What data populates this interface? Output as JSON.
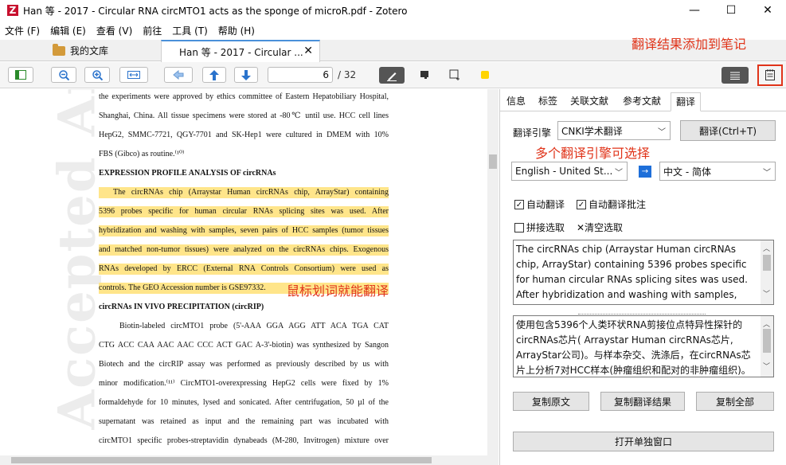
{
  "window": {
    "app_logo": "Z",
    "title": "Han 等 - 2017 - Circular RNA circMTO1 acts as the sponge of microR.pdf - Zotero",
    "minimize": "—",
    "maximize": "☐",
    "close": "✕"
  },
  "menu": [
    "文件 (F)",
    "编辑 (E)",
    "查看 (V)",
    "前往",
    "工具 (T)",
    "帮助 (H)"
  ],
  "tabs": {
    "library_label": "我的文库",
    "doc_label": "Han 等 - 2017 - Circular ...",
    "doc_close": "✕"
  },
  "annotations": {
    "note_hint": "翻译结果添加到笔记",
    "engine_hint": "多个翻译引擎可选择",
    "drag_hint": "鼠标划词就能翻译"
  },
  "toolbar": {
    "page_current": "6",
    "page_total": "/ 32"
  },
  "document": {
    "watermark": "Accepted Arti",
    "lines": [
      {
        "text": "the experiments were approved by ethics committee of Eastern Hepatobiliary Hospital,",
        "style": ""
      },
      {
        "text": "Shanghai, China. All tissue specimens were stored at -80℃ until use. HCC cell lines",
        "style": ""
      },
      {
        "text": "HepG2, SMMC-7721, QGY-7701 and SK-Hep1 were cultured in DMEM with 10%",
        "style": ""
      },
      {
        "text": "FBS (Gibco) as routine.⁽¹⁰⁾",
        "style": "last"
      },
      {
        "text": "EXPRESSION PROFILE ANALYSIS OF circRNAs",
        "style": "heading last"
      },
      {
        "text": "The circRNAs chip (Arraystar Human circRNAs chip, ArrayStar) containing",
        "style": "hl indent-small"
      },
      {
        "text": "5396 probes specific for human circular RNAs splicing sites was used. After",
        "style": "hl"
      },
      {
        "text": "hybridization and washing with samples, seven pairs of HCC samples (tumor tissues",
        "style": "hl"
      },
      {
        "text": "and matched non-tumor tissues) were analyzed on the circRNAs chips. Exogenous",
        "style": "hl"
      },
      {
        "text": "RNAs developed by ERCC (External RNA Controls Consortium) were used as",
        "style": "hl"
      },
      {
        "text": "controls. The GEO Accession number is GSE97332.",
        "style": "hl last"
      },
      {
        "text": "circRNAs IN VIVO PRECIPITATION (circRIP)",
        "style": "heading last"
      },
      {
        "text": "Biotin-labeled circMTO1 probe (5'-AAA GGA AGG ATT ACA TGA CAT",
        "style": "indent"
      },
      {
        "text": "CTG ACC CAA AAC AAC CCC ACT GAC A-3'-biotin) was synthesized by Sangon",
        "style": ""
      },
      {
        "text": "Biotech and the circRIP assay was performed as previously described by us with",
        "style": ""
      },
      {
        "text": "minor modification.⁽¹¹⁾ CircMTO1-overexpressing HepG2 cells were fixed by 1%",
        "style": ""
      },
      {
        "text": "formaldehyde for 10 minutes, lysed and sonicated. After centrifugation, 50 µl of the",
        "style": ""
      },
      {
        "text": "supernatant was retained as input and the remaining part was incubated with",
        "style": ""
      },
      {
        "text": "circMTO1 specific probes-streptavidin dynabeads (M-280, Invitrogen) mixture over",
        "style": ""
      }
    ]
  },
  "panel": {
    "tabs": [
      "信息",
      "标签",
      "关联文献",
      "参考文献",
      "翻译"
    ],
    "engine_label": "翻译引擎",
    "engine_value": "CNKI学术翻译",
    "translate_button": "翻译(Ctrl+T)",
    "source_lang": "English - United St...",
    "target_lang": "中文 - 简体",
    "swap_icon": "→",
    "auto_translate": "自动翻译",
    "auto_translate_annot": "自动翻译批注",
    "concat_select": "拼接选取",
    "clear_select": "✕清空选取",
    "check_mark": "✓",
    "source_text": "The circRNAs chip (Arraystar Human circRNAs chip, ArrayStar) containing 5396 probes specific for human circular RNAs splicing sites was used. After hybridization and washing with samples, seven pairs of HCC samples (tumor tissues and matched",
    "result_text": "使用包含5396个人类环状RNA剪接位点特异性探针的circRNAs芯片( Arraystar Human circRNAs芯片, ArrayStar公司)。与样本杂交、洗涤后，在circRNAs芯片上分析7对HCC样本(肿瘤组织和配对的非肿瘤组织)。以ERCC(外部RNA对照联盟)开发的外源",
    "copy_source": "复制原文",
    "copy_result": "复制翻译结果",
    "copy_all": "复制全部",
    "open_window": "打开单独窗口"
  }
}
